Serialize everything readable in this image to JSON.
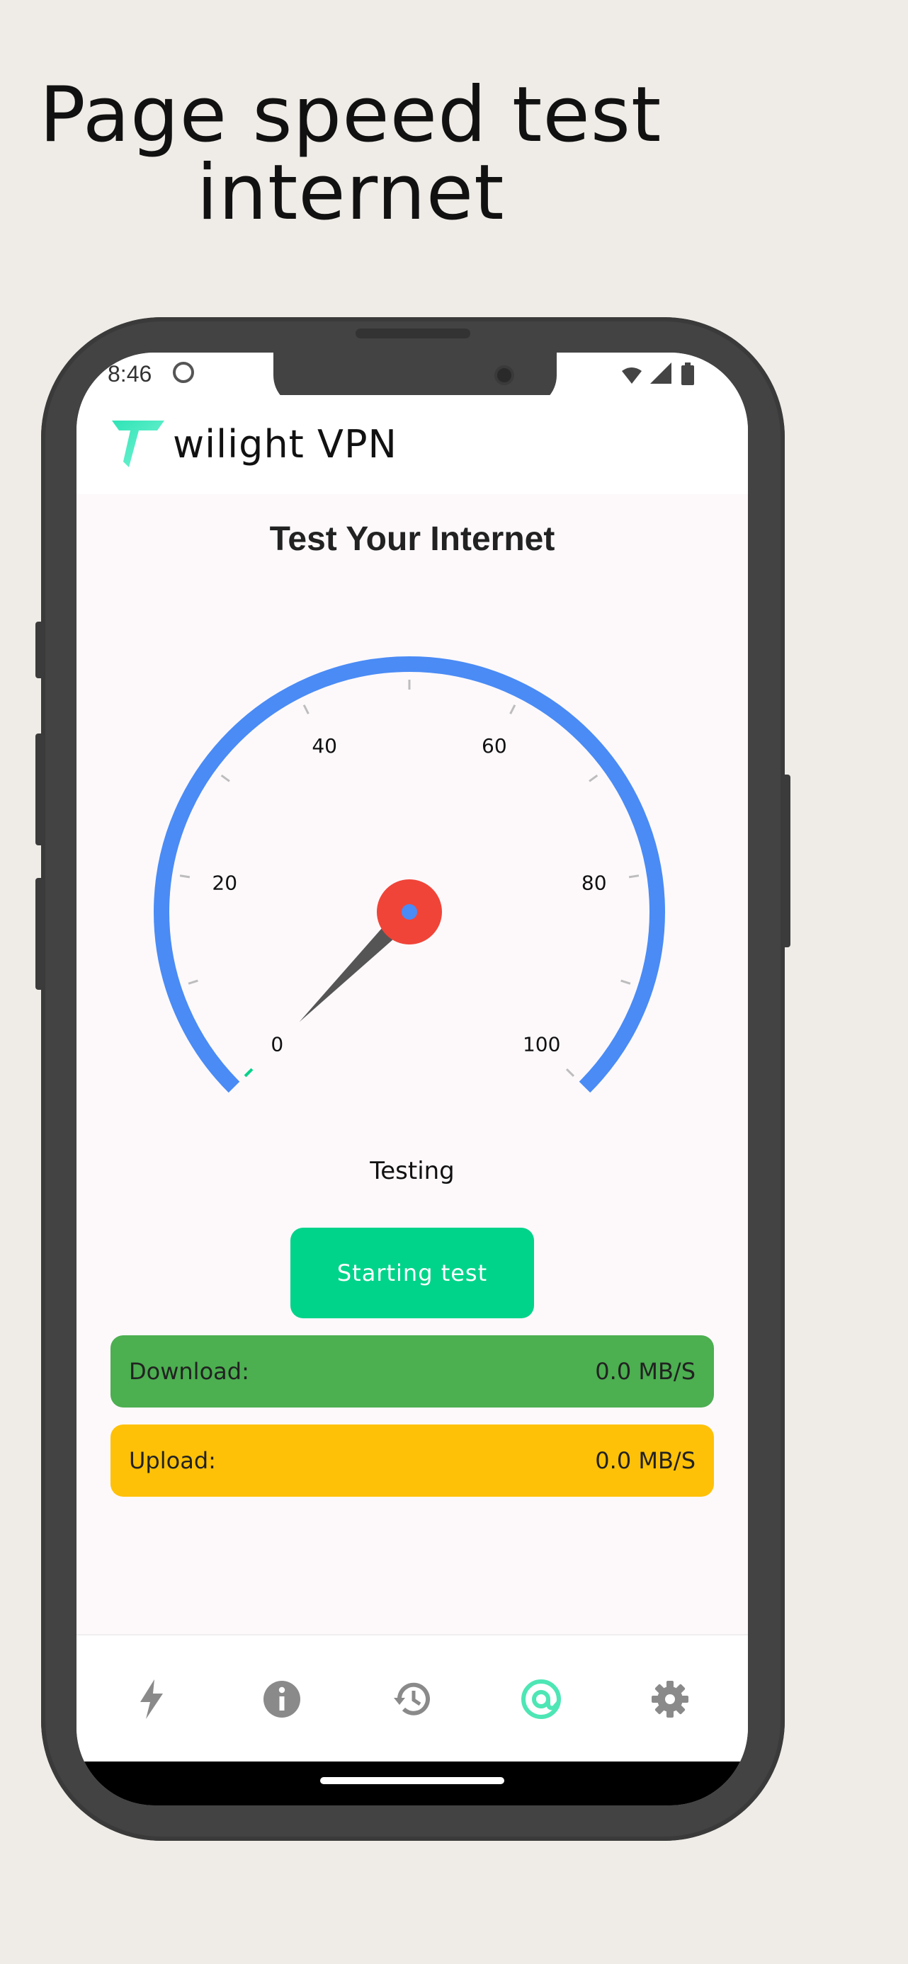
{
  "headline": {
    "line1": "Page speed test",
    "line2": "internet"
  },
  "status_bar": {
    "time": "8:46"
  },
  "app": {
    "title": "wilight VPN"
  },
  "main": {
    "title": "Test Your Internet",
    "gauge": {
      "min": 0,
      "max": 100,
      "value": 0,
      "tick_labels": [
        "0",
        "20",
        "40",
        "60",
        "80",
        "100"
      ]
    },
    "status": "Testing",
    "start_button": "Starting test"
  },
  "results": {
    "download": {
      "label": "Download:",
      "value": "0.0 MB/S",
      "color": "#4caf50"
    },
    "upload": {
      "label": "Upload:",
      "value": "0.0 MB/S",
      "color": "#ffc107"
    }
  },
  "bottom_nav": {
    "items": [
      {
        "icon": "bolt-icon",
        "active": false
      },
      {
        "icon": "info-icon",
        "active": false
      },
      {
        "icon": "history-icon",
        "active": false
      },
      {
        "icon": "at-target-icon",
        "active": true
      },
      {
        "icon": "gear-icon",
        "active": false
      }
    ]
  },
  "colors": {
    "accent": "#00d48a",
    "gauge_arc": "#4a8bf5",
    "needle_hub": "#f04438",
    "nav_active": "#4de6b4",
    "nav_inactive": "#8a8a8a"
  }
}
